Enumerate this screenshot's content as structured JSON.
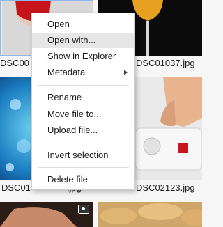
{
  "gallery": {
    "items": [
      {
        "caption": "DSC00",
        "thumb": "wine-glass-photo"
      },
      {
        "caption": "DSC01037.jpg",
        "thumb": "champagne-glass-photo"
      },
      {
        "caption": "DSC01",
        "caption_tail": ".jpg",
        "thumb": "water-splash-photo"
      },
      {
        "caption": "DSC02123.jpg",
        "thumb": "power-strip-photo"
      },
      {
        "caption": "",
        "thumb": "hand-photo"
      },
      {
        "caption": "",
        "thumb": "pastry-photo"
      }
    ]
  },
  "context_menu": {
    "items": [
      {
        "label": "Open"
      },
      {
        "label": "Open with...",
        "highlighted": true
      },
      {
        "label": "Show in Explorer"
      },
      {
        "label": "Metadata",
        "submenu": true
      },
      {
        "label": "Rename"
      },
      {
        "label": "Move file to..."
      },
      {
        "label": "Upload file..."
      },
      {
        "label": "Invert selection"
      },
      {
        "label": "Delete file"
      }
    ]
  }
}
